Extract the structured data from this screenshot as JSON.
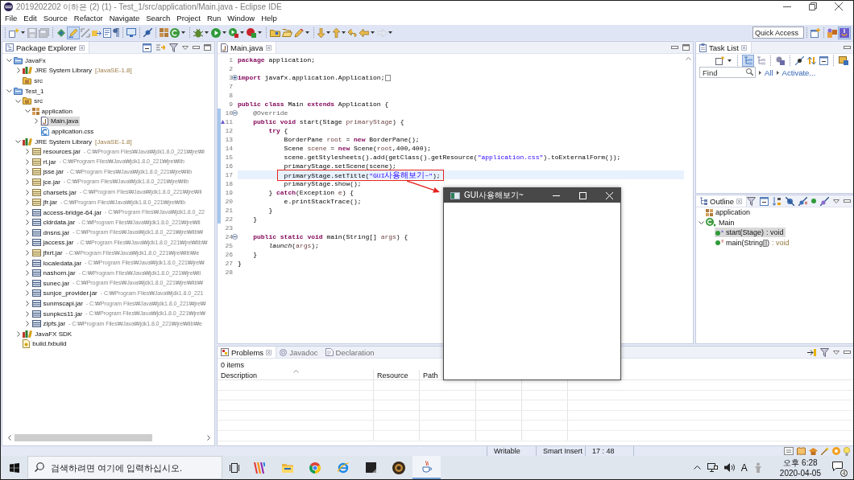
{
  "window": {
    "title": "2019202202 이하은 (2) (1) - Test_1/src/application/Main.java - Eclipse IDE"
  },
  "menu": [
    "File",
    "Edit",
    "Source",
    "Refactor",
    "Navigate",
    "Search",
    "Project",
    "Run",
    "Window",
    "Help"
  ],
  "toolbar": {
    "groups": [
      [
        {
          "kind": "new",
          "dropdown": true,
          "disabled": false,
          "pressed": false
        },
        {
          "kind": "save",
          "dropdown": false,
          "disabled": true,
          "pressed": false
        },
        {
          "kind": "save-all",
          "dropdown": false,
          "disabled": true,
          "pressed": false
        }
      ],
      [
        {
          "kind": "task",
          "dropdown": false,
          "disabled": false,
          "pressed": false
        },
        {
          "kind": "highlight",
          "dropdown": false,
          "disabled": false,
          "pressed": true
        },
        {
          "kind": "block",
          "dropdown": false,
          "disabled": false,
          "pressed": false
        },
        {
          "kind": "breadcrumb",
          "dropdown": false,
          "disabled": false,
          "pressed": false
        },
        {
          "kind": "wrap",
          "dropdown": false,
          "disabled": false,
          "pressed": false
        },
        {
          "kind": "whitespace",
          "dropdown": false,
          "disabled": false,
          "pressed": false
        }
      ],
      [
        {
          "kind": "console",
          "dropdown": false,
          "disabled": false,
          "pressed": false
        }
      ],
      [
        {
          "kind": "skip",
          "dropdown": false,
          "disabled": false,
          "pressed": false
        }
      ],
      [
        {
          "kind": "package",
          "dropdown": false,
          "disabled": false,
          "pressed": false
        },
        {
          "kind": "class",
          "dropdown": true,
          "disabled": false,
          "pressed": false
        }
      ],
      [
        {
          "kind": "debug",
          "dropdown": true,
          "disabled": false,
          "pressed": false
        },
        {
          "kind": "run",
          "dropdown": true,
          "disabled": false,
          "pressed": false
        },
        {
          "kind": "coverage",
          "dropdown": true,
          "disabled": false,
          "pressed": false
        },
        {
          "kind": "tools",
          "dropdown": true,
          "disabled": false,
          "pressed": false
        }
      ],
      [
        {
          "kind": "type",
          "dropdown": false,
          "disabled": false,
          "pressed": false
        },
        {
          "kind": "open",
          "dropdown": false,
          "disabled": false,
          "pressed": false
        },
        {
          "kind": "search",
          "dropdown": true,
          "disabled": false,
          "pressed": false
        }
      ],
      [
        {
          "kind": "next",
          "dropdown": true,
          "disabled": false,
          "pressed": false
        },
        {
          "kind": "previous",
          "dropdown": true,
          "disabled": false,
          "pressed": false
        },
        {
          "kind": "last-edit",
          "dropdown": false,
          "disabled": false,
          "pressed": false
        },
        {
          "kind": "back",
          "dropdown": true,
          "disabled": false,
          "pressed": false
        },
        {
          "kind": "forward",
          "dropdown": true,
          "disabled": true,
          "pressed": false
        }
      ]
    ],
    "quick_access": {
      "placeholder": "Quick Access"
    },
    "perspectives": [
      {
        "kind": "enterprise",
        "selected": false
      },
      {
        "kind": "java",
        "selected": true
      }
    ]
  },
  "package_explorer": {
    "title": "Package Explorer",
    "tree": [
      {
        "label": "JavaFx",
        "kind": "project",
        "expanded": true,
        "selected": false,
        "children": [
          {
            "label": "JRE System Library",
            "detail": "[JavaSE-1.8]",
            "kind": "library",
            "expanded": false,
            "selected": false
          },
          {
            "label": "src",
            "kind": "source-folder",
            "selected": false
          }
        ]
      },
      {
        "label": "Test_1",
        "kind": "project",
        "expanded": true,
        "selected": false,
        "children": [
          {
            "label": "src",
            "kind": "source-folder",
            "expanded": true,
            "selected": false,
            "children": [
              {
                "label": "application",
                "kind": "package",
                "expanded": true,
                "selected": false,
                "children": [
                  {
                    "label": "Main.java",
                    "kind": "java-file",
                    "expanded": false,
                    "selected": true
                  },
                  {
                    "label": "application.css",
                    "kind": "css-file",
                    "selected": false
                  }
                ]
              }
            ]
          },
          {
            "label": "JRE System Library",
            "detail": "[JavaSE-1.8]",
            "kind": "library",
            "expanded": true,
            "selected": false,
            "children": [
              {
                "label": "resources.jar",
                "detail": "- C:₩Program Files₩Java₩jdk1.8.0_221₩jre₩l",
                "kind": "jar",
                "expanded": false,
                "selected": false
              },
              {
                "label": "rt.jar",
                "detail": "- C:₩Program Files₩Java₩jdk1.8.0_221₩jre₩lib",
                "kind": "jar",
                "expanded": false,
                "selected": false
              },
              {
                "label": "jsse.jar",
                "detail": "- C:₩Program Files₩Java₩jdk1.8.0_221₩jre₩lib",
                "kind": "jar",
                "expanded": false,
                "selected": false
              },
              {
                "label": "jce.jar",
                "detail": "- C:₩Program Files₩Java₩jdk1.8.0_221₩jre₩lib",
                "kind": "jar",
                "expanded": false,
                "selected": false
              },
              {
                "label": "charsets.jar",
                "detail": "- C:₩Program Files₩Java₩jdk1.8.0_221₩jre₩li",
                "kind": "jar",
                "expanded": false,
                "selected": false
              },
              {
                "label": "jfr.jar",
                "detail": "- C:₩Program Files₩Java₩jdk1.8.0_221₩jre₩lib",
                "kind": "jar",
                "expanded": false,
                "selected": false
              },
              {
                "label": "access-bridge-64.jar",
                "detail": "- C:₩Program Files₩Java₩jdk1.8.0_22",
                "kind": "ext-jar",
                "expanded": false,
                "selected": false
              },
              {
                "label": "cldrdata.jar",
                "detail": "- C:₩Program Files₩Java₩jdk1.8.0_221₩jre₩li",
                "kind": "ext-jar",
                "expanded": false,
                "selected": false
              },
              {
                "label": "dnsns.jar",
                "detail": "- C:₩Program Files₩Java₩jdk1.8.0_221₩jre₩lib₩",
                "kind": "ext-jar",
                "expanded": false,
                "selected": false
              },
              {
                "label": "jaccess.jar",
                "detail": "- C:₩Program Files₩Java₩jdk1.8.0_221₩jre₩lib₩",
                "kind": "ext-jar",
                "expanded": false,
                "selected": false
              },
              {
                "label": "jfxrt.jar",
                "detail": "- C:₩Program Files₩Java₩jdk1.8.0_221₩jre₩lib₩e",
                "kind": "jar",
                "expanded": false,
                "selected": false
              },
              {
                "label": "localedata.jar",
                "detail": "- C:₩Program Files₩Java₩jdk1.8.0_221₩jre₩",
                "kind": "ext-jar",
                "expanded": false,
                "selected": false
              },
              {
                "label": "nashorn.jar",
                "detail": "- C:₩Program Files₩Java₩jdk1.8.0_221₩jre₩li",
                "kind": "ext-jar",
                "expanded": false,
                "selected": false
              },
              {
                "label": "sunec.jar",
                "detail": "- C:₩Program Files₩Java₩jdk1.8.0_221₩jre₩lib₩",
                "kind": "ext-jar",
                "expanded": false,
                "selected": false
              },
              {
                "label": "sunjce_provider.jar",
                "detail": "- C:₩Program Files₩Java₩jdk1.8.0_221",
                "kind": "ext-jar",
                "expanded": false,
                "selected": false
              },
              {
                "label": "sunmscapi.jar",
                "detail": "- C:₩Program Files₩Java₩jdk1.8.0_221₩jre₩",
                "kind": "ext-jar",
                "expanded": false,
                "selected": false
              },
              {
                "label": "sunpkcs11.jar",
                "detail": "- C:₩Program Files₩Java₩jdk1.8.0_221₩jre₩",
                "kind": "ext-jar",
                "expanded": false,
                "selected": false
              },
              {
                "label": "zipfs.jar",
                "detail": "- C:₩Program Files₩Java₩jdk1.8.0_221₩jre₩lib₩e",
                "kind": "ext-jar",
                "expanded": false,
                "selected": false
              }
            ]
          },
          {
            "label": "JavaFX SDK",
            "kind": "library",
            "expanded": false,
            "selected": false
          },
          {
            "label": "build.fxbuild",
            "kind": "build-file",
            "selected": false
          }
        ]
      }
    ]
  },
  "editor": {
    "tabs": [
      {
        "label": "Main.java",
        "selected": true
      }
    ],
    "lines": [
      {
        "number": "1",
        "current": false,
        "in_range": false,
        "override": false,
        "boxed": false,
        "tokens": [
          {
            "kind": "keyword",
            "text": "package"
          },
          {
            "kind": "plain",
            "text": " application;"
          }
        ]
      },
      {
        "number": "2",
        "current": false,
        "in_range": false,
        "override": false,
        "boxed": false
      },
      {
        "number": "3",
        "folded": true,
        "current": false,
        "in_range": false,
        "override": false,
        "boxed": false,
        "tokens": [
          {
            "kind": "keyword",
            "text": "import"
          },
          {
            "kind": "plain",
            "text": " javafx.application.Application;"
          }
        ]
      },
      {
        "number": "7",
        "current": false,
        "in_range": false,
        "override": false,
        "boxed": false
      },
      {
        "number": "8",
        "current": false,
        "in_range": false,
        "override": false,
        "boxed": false
      },
      {
        "number": "9",
        "current": false,
        "in_range": false,
        "override": false,
        "boxed": false,
        "tokens": [
          {
            "kind": "keyword",
            "text": "public class"
          },
          {
            "kind": "plain",
            "text": " Main "
          },
          {
            "kind": "keyword",
            "text": "extends"
          },
          {
            "kind": "plain",
            "text": " Application {"
          }
        ]
      },
      {
        "number": "10",
        "folded": false,
        "current": false,
        "in_range": true,
        "override": false,
        "boxed": false,
        "tokens": [
          {
            "kind": "annotation",
            "text": "    @Override"
          }
        ]
      },
      {
        "number": "11",
        "current": false,
        "in_range": true,
        "override": true,
        "boxed": false,
        "tokens": [
          {
            "kind": "keyword",
            "text": "    public void"
          },
          {
            "kind": "plain",
            "text": " start(Stage "
          },
          {
            "kind": "variable",
            "text": "primaryStage"
          },
          {
            "kind": "plain",
            "text": ") {"
          }
        ]
      },
      {
        "number": "12",
        "current": false,
        "in_range": true,
        "override": false,
        "boxed": false,
        "tokens": [
          {
            "kind": "keyword",
            "text": "        try"
          },
          {
            "kind": "plain",
            "text": " {"
          }
        ]
      },
      {
        "number": "13",
        "current": false,
        "in_range": true,
        "override": false,
        "boxed": false,
        "tokens": [
          {
            "kind": "plain",
            "text": "            BorderPane "
          },
          {
            "kind": "variable",
            "text": "root"
          },
          {
            "kind": "plain",
            "text": " = "
          },
          {
            "kind": "keyword",
            "text": "new"
          },
          {
            "kind": "plain",
            "text": " BorderPane();"
          }
        ]
      },
      {
        "number": "14",
        "current": false,
        "in_range": true,
        "override": false,
        "boxed": false,
        "tokens": [
          {
            "kind": "plain",
            "text": "            Scene "
          },
          {
            "kind": "variable",
            "text": "scene"
          },
          {
            "kind": "plain",
            "text": " = "
          },
          {
            "kind": "keyword",
            "text": "new"
          },
          {
            "kind": "plain",
            "text": " Scene("
          },
          {
            "kind": "variable",
            "text": "root"
          },
          {
            "kind": "plain",
            "text": ",400,400);"
          }
        ]
      },
      {
        "number": "15",
        "current": false,
        "in_range": true,
        "override": false,
        "boxed": false,
        "tokens": [
          {
            "kind": "plain",
            "text": "            scene.getStylesheets().add(getClass().getResource("
          },
          {
            "kind": "string",
            "text": "\"application.css\""
          },
          {
            "kind": "plain",
            "text": ").toExternalForm());"
          }
        ]
      },
      {
        "number": "16",
        "current": false,
        "in_range": true,
        "override": false,
        "boxed": false,
        "tokens": [
          {
            "kind": "plain",
            "text": "            primaryStage.setScene(scene);"
          }
        ]
      },
      {
        "number": "17",
        "current": true,
        "in_range": true,
        "override": false,
        "boxed": true,
        "tokens": [
          {
            "kind": "plain",
            "text": "            primaryStage.setTitle("
          },
          {
            "kind": "string",
            "text": "\"GUI사용해보기~\""
          },
          {
            "kind": "plain",
            "text": ");"
          }
        ]
      },
      {
        "number": "18",
        "current": false,
        "in_range": true,
        "override": false,
        "boxed": false,
        "tokens": [
          {
            "kind": "plain",
            "text": "            primaryStage.show();"
          }
        ]
      },
      {
        "number": "19",
        "current": false,
        "in_range": true,
        "override": false,
        "boxed": false,
        "tokens": [
          {
            "kind": "plain",
            "text": "        } "
          },
          {
            "kind": "keyword",
            "text": "catch"
          },
          {
            "kind": "plain",
            "text": "(Exception "
          },
          {
            "kind": "variable",
            "text": "e"
          },
          {
            "kind": "plain",
            "text": ") {"
          }
        ]
      },
      {
        "number": "20",
        "current": false,
        "in_range": true,
        "override": false,
        "boxed": false,
        "tokens": [
          {
            "kind": "plain",
            "text": "            e.printStackTrace();"
          }
        ]
      },
      {
        "number": "21",
        "current": false,
        "in_range": true,
        "override": false,
        "boxed": false,
        "tokens": [
          {
            "kind": "plain",
            "text": "        }"
          }
        ]
      },
      {
        "number": "22",
        "current": false,
        "in_range": true,
        "override": false,
        "boxed": false,
        "tokens": [
          {
            "kind": "plain",
            "text": "    }"
          }
        ]
      },
      {
        "number": "23",
        "current": false,
        "in_range": false,
        "override": false,
        "boxed": false
      },
      {
        "number": "24",
        "folded": false,
        "current": false,
        "in_range": false,
        "override": false,
        "boxed": false,
        "tokens": [
          {
            "kind": "keyword",
            "text": "    public static void"
          },
          {
            "kind": "plain",
            "text": " main(String[] "
          },
          {
            "kind": "variable",
            "text": "args"
          },
          {
            "kind": "plain",
            "text": ") {"
          }
        ]
      },
      {
        "number": "25",
        "current": false,
        "in_range": false,
        "override": false,
        "boxed": false,
        "tokens": [
          {
            "kind": "static",
            "text": "        launch"
          },
          {
            "kind": "plain",
            "text": "("
          },
          {
            "kind": "variable",
            "text": "args"
          },
          {
            "kind": "plain",
            "text": ");"
          }
        ]
      },
      {
        "number": "26",
        "current": false,
        "in_range": false,
        "override": false,
        "boxed": false,
        "tokens": [
          {
            "kind": "plain",
            "text": "    }"
          }
        ]
      },
      {
        "number": "27",
        "current": false,
        "in_range": false,
        "override": false,
        "boxed": false,
        "tokens": [
          {
            "kind": "plain",
            "text": "}"
          }
        ]
      },
      {
        "number": "28",
        "current": false,
        "in_range": false,
        "override": false,
        "boxed": false
      }
    ]
  },
  "task_list": {
    "title": "Task List",
    "toolbar": [
      [
        {
          "kind": "new-task",
          "dropdown": true,
          "pressed": false
        }
      ],
      [
        {
          "kind": "categorized",
          "dropdown": false,
          "pressed": true
        },
        {
          "kind": "scheduled",
          "dropdown": false,
          "pressed": false
        }
      ],
      [
        {
          "kind": "hide-completed",
          "dropdown": false,
          "pressed": false
        }
      ],
      [
        {
          "kind": "focus",
          "dropdown": false,
          "pressed": false
        },
        {
          "kind": "sync",
          "dropdown": false,
          "pressed": false
        },
        {
          "kind": "collapse",
          "dropdown": false,
          "pressed": false
        }
      ],
      [
        {
          "kind": "presentation",
          "dropdown": false,
          "pressed": false
        }
      ]
    ],
    "find": {
      "placeholder": "Find"
    },
    "filters": [
      "All",
      "Activate..."
    ]
  },
  "outline": {
    "title": "Outline",
    "tree": [
      {
        "label": "application",
        "kind": "package",
        "selected": false
      },
      {
        "label": "Main",
        "kind": "class",
        "expanded": true,
        "selected": false,
        "children": [
          {
            "label": "start(Stage)",
            "type": ": void",
            "kind": "method",
            "selected": true
          },
          {
            "label": "main(String[])",
            "type": ": void",
            "kind": "static-method",
            "selected": false
          }
        ]
      }
    ]
  },
  "problems": {
    "tabs": [
      {
        "label": "Problems",
        "kind": "problems",
        "selected": true
      },
      {
        "label": "Javadoc",
        "kind": "javadoc",
        "selected": false
      },
      {
        "label": "Declaration",
        "kind": "declaration",
        "selected": false
      }
    ],
    "summary": "0 items",
    "columns": [
      "Description",
      "Resource",
      "Path"
    ]
  },
  "status_bar": {
    "fields": [
      "Writable",
      "Smart Insert",
      "17 : 48"
    ]
  },
  "taskbar": {
    "search": {
      "placeholder": "검색하려면 여기에 입력하십시오."
    },
    "apps": [
      {
        "kind": "task-view",
        "active": false
      },
      {
        "kind": "stripes",
        "active": false
      },
      {
        "kind": "folder",
        "active": false
      },
      {
        "kind": "tricolor",
        "active": false
      },
      {
        "kind": "e-ring",
        "active": false
      },
      {
        "kind": "black-tile",
        "active": false
      },
      {
        "kind": "emblem",
        "active": false
      },
      {
        "kind": "coffee-cup",
        "active": true
      }
    ],
    "ime": "A",
    "clock": {
      "time": "오후 6:28",
      "date": "2020-04-05"
    },
    "notifications": "4"
  },
  "app_window": {
    "title": "GUI사용해보기~"
  }
}
